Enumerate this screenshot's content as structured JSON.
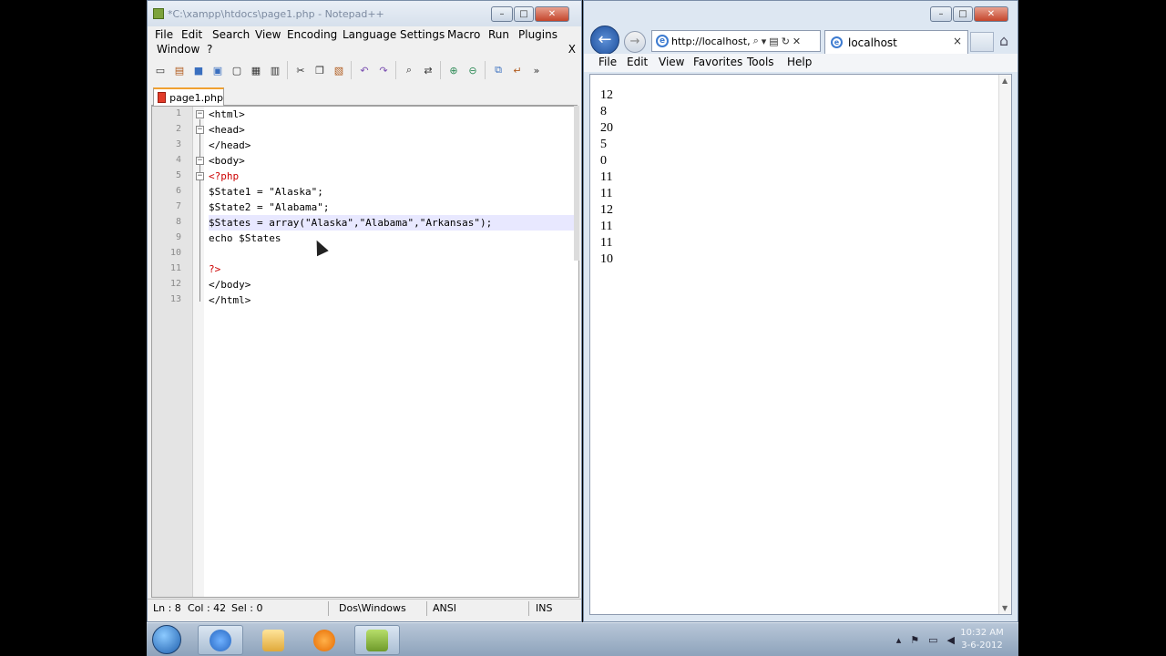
{
  "notepad": {
    "title": "*C:\\xampp\\htdocs\\page1.php - Notepad++",
    "menu": [
      "File",
      "Edit",
      "Search",
      "View",
      "Encoding",
      "Language",
      "Settings",
      "Macro",
      "Run",
      "Plugins",
      "Window",
      "?"
    ],
    "close_doc": "X",
    "tab_name": "page1.php",
    "line_numbers": [
      "1",
      "2",
      "3",
      "4",
      "5",
      "6",
      "7",
      "8",
      "9",
      "10",
      "11",
      "12",
      "13"
    ],
    "code_lines": [
      "<html>",
      "<head>",
      "</head>",
      "<body>",
      "<?php",
      "$State1 = \"Alaska\";",
      "$State2 = \"Alabama\";",
      "$States = array(\"Alaska\",\"Alabama\",\"Arkansas\");",
      "echo $States",
      "",
      "?>",
      "</body>",
      "</html>"
    ],
    "status": {
      "ln": "Ln : 8",
      "col": "Col : 42",
      "sel": "Sel : 0",
      "eol": "Dos\\Windows",
      "encoding": "ANSI",
      "mode": "INS"
    }
  },
  "browser": {
    "url": "http://localhost,",
    "tab_title": "localhost",
    "tab_close": "×",
    "menu": [
      "File",
      "Edit",
      "View",
      "Favorites",
      "Tools",
      "Help"
    ],
    "output_lines": [
      "12",
      "8",
      "20",
      "5",
      "0",
      "11",
      "11",
      "12",
      "11",
      "11",
      "10"
    ]
  },
  "taskbar": {
    "clock_time": "10:32 AM",
    "clock_date": "3-6-2012"
  }
}
